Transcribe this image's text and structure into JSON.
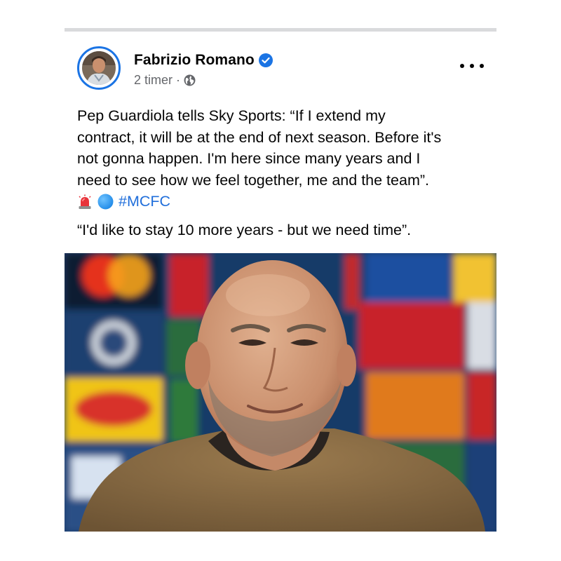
{
  "post": {
    "author": "Fabrizio Romano",
    "time": "2 timer",
    "separator": "·",
    "text_lines": [
      "Pep Guardiola tells Sky Sports: “If I extend my",
      "contract, it will be at the end of next season. Before it's",
      "not gonna happen. I'm here since many years and I",
      "need to see how we feel together, me and the team”."
    ],
    "emojis": [
      "siren-emoji",
      "blue-circle-emoji"
    ],
    "hashtag": "#MCFC",
    "quote": "“I'd like to stay 10 more years - but we need time”."
  },
  "icons": {
    "verified": "verified-badge-icon",
    "audience": "globe-icon",
    "more": "more-options-icon"
  },
  "colors": {
    "verified_blue": "#1b74e4",
    "hashtag": "#216fdb",
    "meta_gray": "#65676b",
    "divider": "#d9dadc"
  }
}
